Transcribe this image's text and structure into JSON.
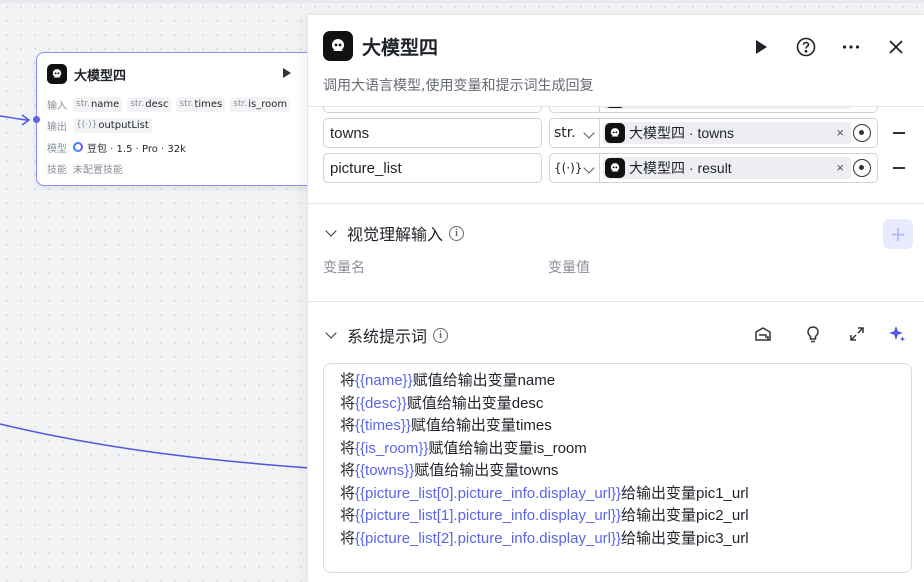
{
  "node": {
    "title": "大模型四",
    "inputs_label": "输入",
    "inputs": [
      {
        "type": "str.",
        "name": "name"
      },
      {
        "type": "str.",
        "name": "desc"
      },
      {
        "type": "str.",
        "name": "times"
      },
      {
        "type": "str.",
        "name": "is_room"
      }
    ],
    "outputs_label": "输出",
    "output": {
      "type": "{(·)}",
      "name": "outputList"
    },
    "model_label": "模型",
    "model_value": "豆包 · 1.5 · Pro · 32k",
    "skills_label": "技能",
    "skills_value": "未配置技能"
  },
  "panel": {
    "title": "大模型四",
    "description": "调用大语言模型,使用变量和提示词生成回复",
    "variables": [
      {
        "name": "towns",
        "type": "str.",
        "ref_source": "大模型四",
        "ref_field": "towns"
      },
      {
        "name": "picture_list",
        "type": "{(·)}",
        "ref_source": "大模型四",
        "ref_field": "result"
      }
    ],
    "vision_section": {
      "title": "视觉理解输入",
      "col_name": "变量名",
      "col_value": "变量值",
      "add_label": "+"
    },
    "prompt_section": {
      "title": "系统提示词",
      "lines": [
        {
          "pre": "将",
          "var": "{{name}}",
          "post": "赋值给输出变量name"
        },
        {
          "pre": "将",
          "var": "{{desc}}",
          "post": "赋值给输出变量desc"
        },
        {
          "pre": "将",
          "var": "{{times}}",
          "post": "赋值给输出变量times"
        },
        {
          "pre": "将",
          "var": "{{is_room}}",
          "post": "赋值给输出变量is_room"
        },
        {
          "pre": "将",
          "var": "{{towns}}",
          "post": "赋值给输出变量towns"
        },
        {
          "pre": "将",
          "var": "{{picture_list[0].picture_info.display_url}}",
          "post": "给输出变量pic1_url"
        },
        {
          "pre": "将",
          "var": "{{picture_list[1].picture_info.display_url}}",
          "post": "给输出变量pic2_url"
        },
        {
          "pre": "将",
          "var": "{{picture_list[2].picture_info.display_url}}",
          "post": "给输出变量pic3_url"
        }
      ]
    }
  },
  "colors": {
    "accent": "#5b65e8",
    "edge": "#4f57e0",
    "node_border": "#8b8ff3"
  },
  "icons": [
    "bot-logo-icon",
    "run-icon",
    "help-icon",
    "more-icon",
    "close-icon",
    "chevron-down-icon",
    "info-icon",
    "target-icon",
    "minus-icon",
    "library-icon",
    "bulb-icon",
    "expand-icon",
    "sparkle-icon"
  ]
}
